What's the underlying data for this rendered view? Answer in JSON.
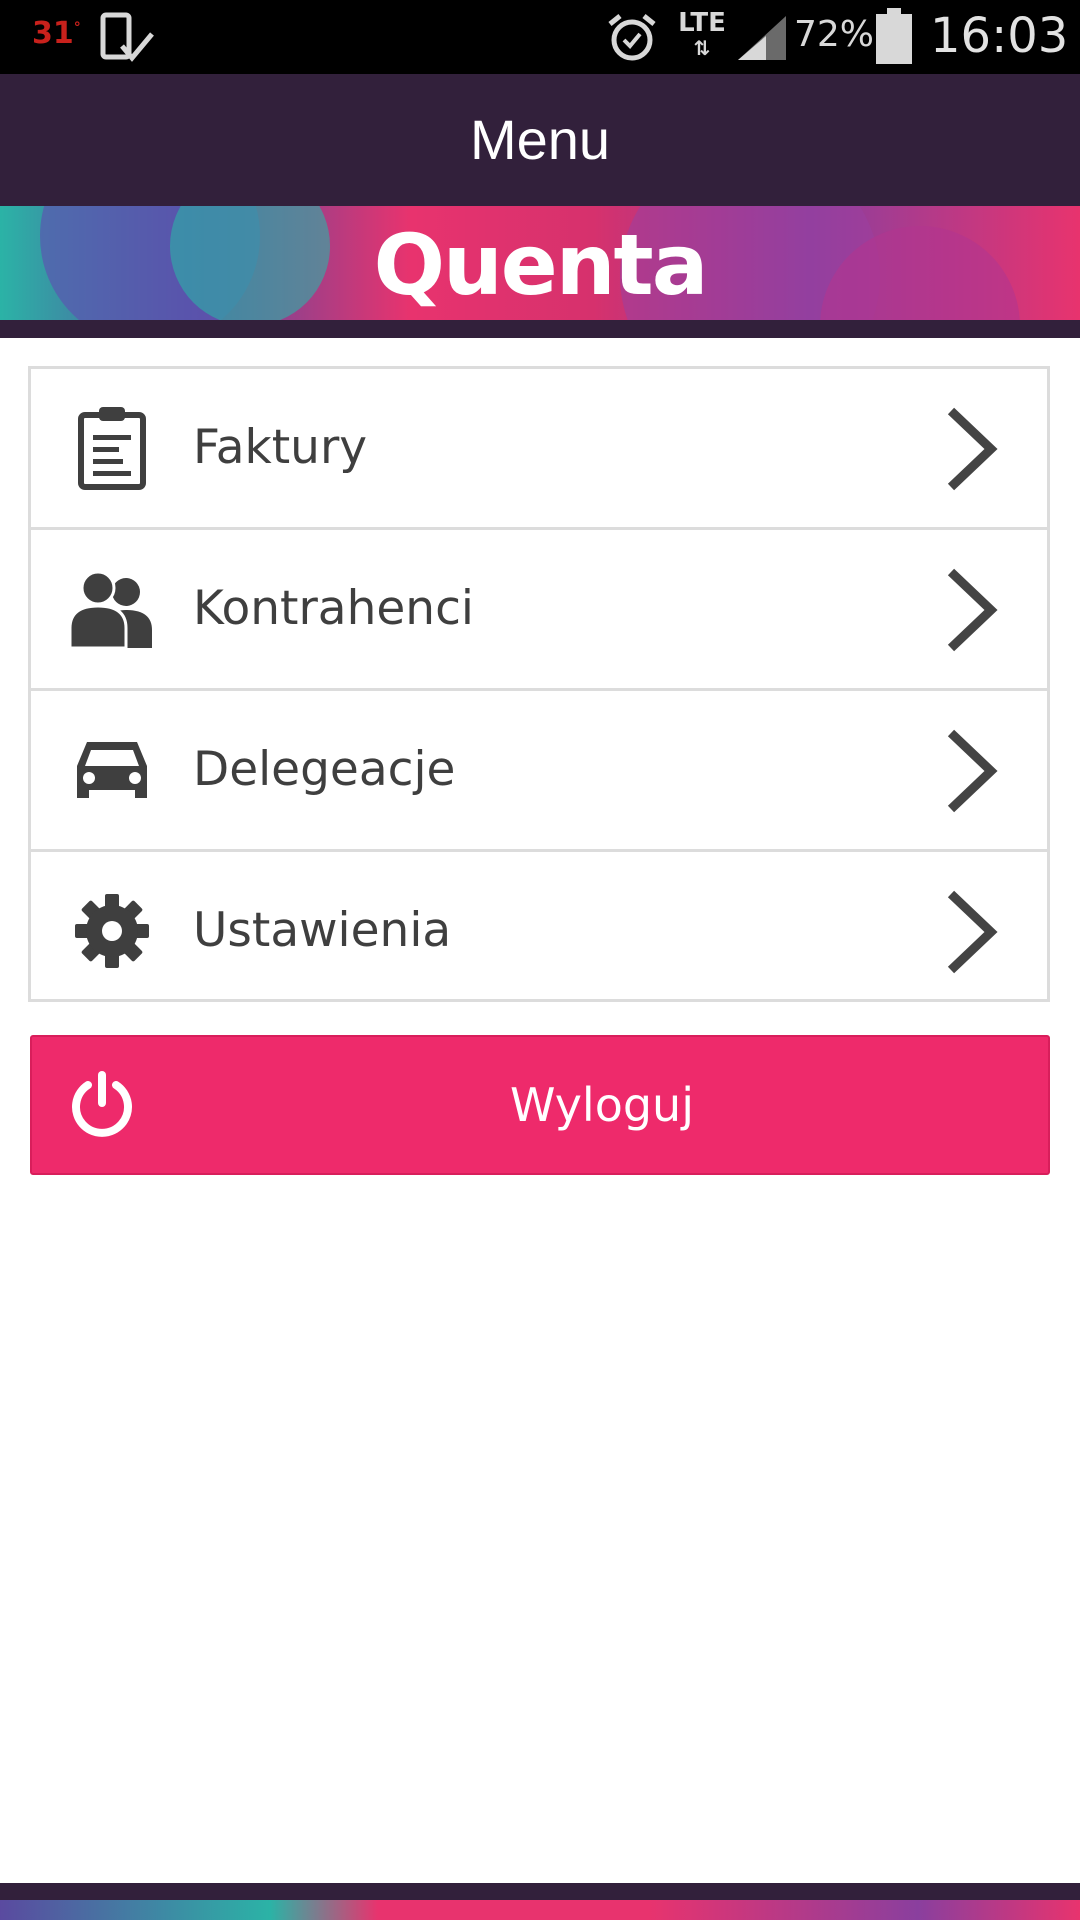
{
  "status_bar": {
    "temperature": "31",
    "temperature_unit": "°",
    "network": "LTE",
    "battery_percent": "72%",
    "battery_level": 0.72,
    "time": "16:03",
    "icons": [
      "phone-check-icon",
      "alarm-icon",
      "lte-icon",
      "signal-icon",
      "battery-icon"
    ]
  },
  "header": {
    "title": "Menu"
  },
  "banner": {
    "logo_text": "Quenta"
  },
  "menu": {
    "items": [
      {
        "label": "Faktury",
        "icon": "clipboard-icon"
      },
      {
        "label": "Kontrahenci",
        "icon": "users-icon"
      },
      {
        "label": "Delegeacje",
        "icon": "car-icon"
      },
      {
        "label": "Ustawienia",
        "icon": "gear-icon"
      }
    ]
  },
  "logout": {
    "label": "Wyloguj",
    "icon": "power-icon"
  },
  "colors": {
    "status_bar_bg": "#000000",
    "header_bg": "#32203b",
    "accent_pink": "#ee2a6b",
    "text_dark": "#3f3f3f",
    "border": "#dcdcdc",
    "temperature": "#c8211c"
  }
}
